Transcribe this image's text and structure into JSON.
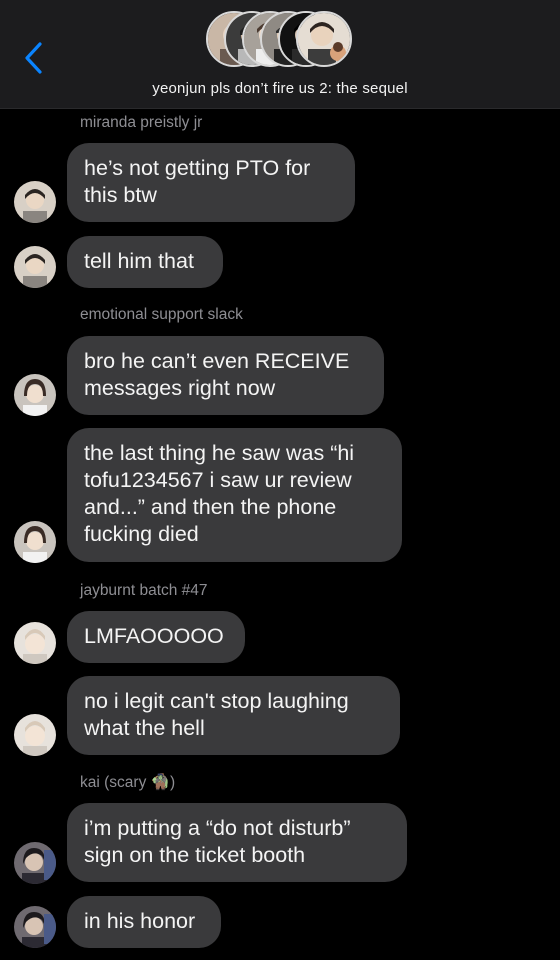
{
  "header": {
    "title": "yeonjun pls don’t fire us 2: the sequel"
  },
  "messages": [
    {
      "sender": "miranda preistly jr",
      "text": "he’s not getting PTO for\nthis btw"
    },
    {
      "text": "tell him that"
    },
    {
      "sender": "emotional support slack",
      "text": "bro he can’t even RECEIVE\nmessages right now"
    },
    {
      "text": "the last thing he saw was “hi\ntofu1234567 i saw ur review\nand...” and then the phone\nfucking died"
    },
    {
      "sender": "jayburnt batch #47",
      "text": "LMFAOOOOO"
    },
    {
      "text": "no i legit can't stop laughing\nwhat the hell"
    },
    {
      "sender_prefix": "kai (scary ",
      "sender_emoji": "🧌",
      "sender_suffix": ")",
      "text": "i’m putting a “do not disturb”\nsign on the ticket booth"
    },
    {
      "text": "in his honor"
    }
  ],
  "colors": {
    "background": "#000000",
    "header_bg": "#1c1c1e",
    "bubble_bg": "#3a3a3c",
    "back_arrow": "#0a84ff",
    "sender_text": "#8e8e93"
  }
}
